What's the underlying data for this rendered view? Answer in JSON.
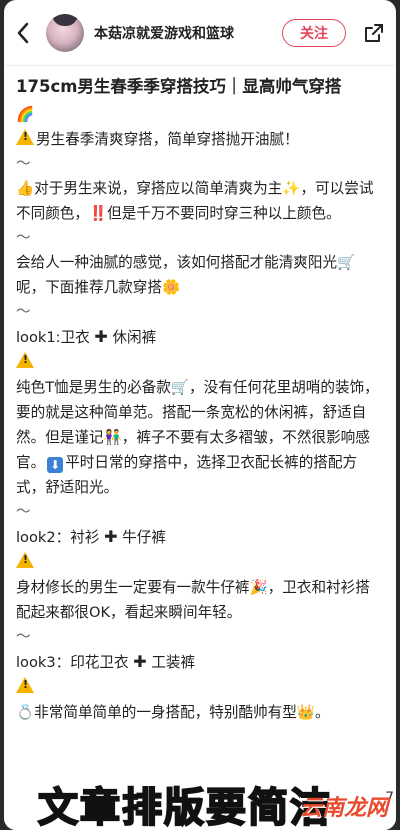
{
  "header": {
    "author": "本菇凉就爱游戏和篮球",
    "follow_label": "关注"
  },
  "post": {
    "title": "175cm男生春季季穿搭技巧｜显高帅气穿搭",
    "title_emoji": "🌈",
    "p1": "男生春季清爽穿搭，简单穿搭抛开油腻！",
    "tilde": "～",
    "p2a": "对于男生来说，穿搭应以简单清爽为主",
    "p2b": "，可以尝试不同颜色，",
    "p2c": "但是千万不要同时穿三种以上颜色。",
    "p3a": "会给人一种油腻的感觉，该如何搭配才能清爽阳光",
    "p3b": "呢，下面推荐几款穿搭",
    "look1_label": "look1:卫衣",
    "look1_item": "休闲裤",
    "p4a": "纯色T恤是男生的必备款",
    "p4b": "，没有任何花里胡哨的装饰，要的就是这种简单范。搭配一条宽松的休闲裤，舒适自然。但是谨记",
    "p4c": "，裤子不要有太多褶皱，不然很影响感官。",
    "p4d": "平时日常的穿搭中，选择卫衣配长裤的搭配方式，舒适阳光。",
    "look2_label": "look2：衬衫",
    "look2_item": "牛仔裤",
    "p5a": "身材修长的男生一定要有一款牛仔裤",
    "p5b": "，卫衣和衬衫搭配起来都很OK，看起来瞬间年轻。",
    "look3_label": "look3：印花卫衣",
    "look3_item": "工装裤",
    "p6a": "非常简单简单的一身搭配，特别酷帅有型"
  },
  "overlay": {
    "caption": "文章排版要简洁",
    "watermark": "云南龙网",
    "page_fragment": "7"
  },
  "icons": {
    "thumbs_up": "👍",
    "sparkles": "✨",
    "double_exclaim": "‼️",
    "cart": "🛒",
    "flower": "🌼",
    "couple": "👫",
    "down_arrow": "⬇",
    "party": "🎉",
    "ring": "💍",
    "crown": "👑"
  },
  "colors": {
    "accent": "#e8455a",
    "warning": "#f4b400"
  }
}
